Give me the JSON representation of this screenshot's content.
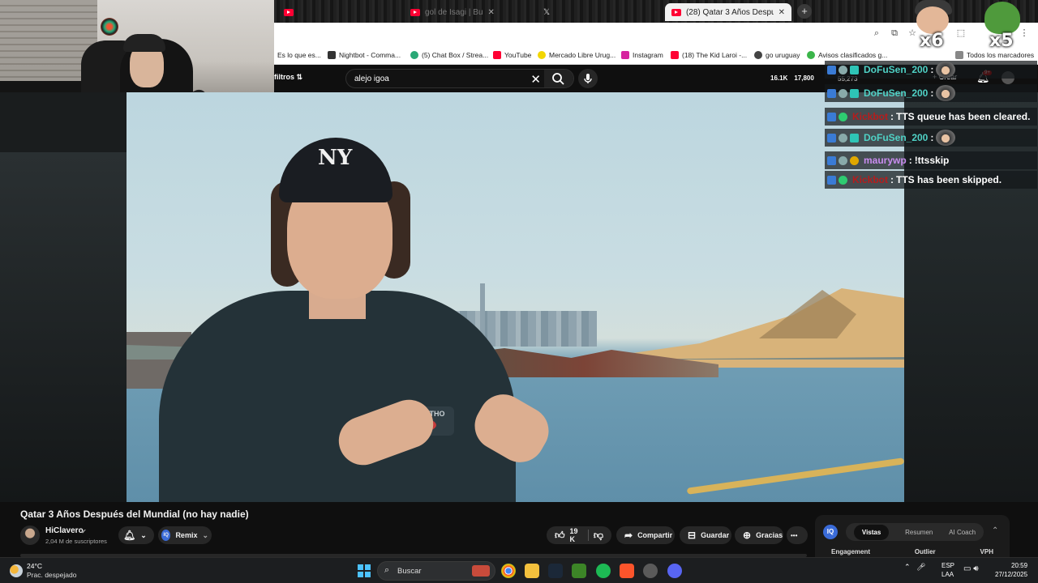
{
  "browser": {
    "tabs": [
      {
        "label": "",
        "icon": "youtube-icon"
      },
      {
        "label": "gol de Isagi | Bu",
        "icon": "youtube-icon"
      },
      {
        "label": "",
        "icon": "x-icon"
      },
      {
        "label": "(28) Qatar 3 Años Después del",
        "icon": "youtube-icon",
        "active": true
      }
    ],
    "new_tab": "+",
    "bookmarks": [
      {
        "label": "Es lo que es...",
        "color": "#888888"
      },
      {
        "label": "Nightbot - Comma...",
        "color": "#333333"
      },
      {
        "label": "(5) Chat Box / Strea...",
        "color": "#2aa876"
      },
      {
        "label": "YouTube",
        "color": "#ff0033"
      },
      {
        "label": "Mercado Libre Urug...",
        "color": "#f2d600"
      },
      {
        "label": "Instagram",
        "color": "#d6249f"
      },
      {
        "label": "(18) The Kid Laroi -...",
        "color": "#ff0033"
      },
      {
        "label": "go uruguay",
        "color": "#444444"
      },
      {
        "label": "Avisos clasificados g...",
        "color": "#3bb54a"
      },
      {
        "label": "Todos los marcadores",
        "color": "#666666"
      }
    ]
  },
  "youtube": {
    "filters_label": "filtros",
    "search_value": "alejo igoa",
    "stats": [
      "16.1K",
      "17,800",
      "55,273"
    ],
    "create_label": "Crear",
    "notif_count": "9+",
    "video_title": "Qatar 3 Años Después del Mundial (no hay nadie)",
    "cap_logo": "NY",
    "shirt_text": "BEANYTHO",
    "channel_name": "HiClavero",
    "subscribers": "2,04 M de suscriptores",
    "remix_label": "Remix",
    "likes": "19 K",
    "share_label": "Compartir",
    "save_label": "Guardar",
    "thanks_label": "Gracias",
    "more_label": "•••"
  },
  "chat": [
    {
      "user": "DoFuSen_200",
      "user_color": "#4fd1c5",
      "message": "",
      "emote": true
    },
    {
      "user": "DoFuSen_200",
      "user_color": "#4fd1c5",
      "message": "",
      "emote": true
    },
    {
      "user": "Kickbot",
      "user_color": "#b71c1c",
      "message": "TTS queue has been cleared.",
      "emote": false
    },
    {
      "user": "DoFuSen_200",
      "user_color": "#4fd1c5",
      "message": "",
      "emote": true
    },
    {
      "user": "maurywp",
      "user_color": "#c98cf0",
      "message": "!ttsskip",
      "emote": false
    },
    {
      "user": "Kickbot",
      "user_color": "#b71c1c",
      "message": "TTS has been skipped.",
      "emote": false
    }
  ],
  "overlays": {
    "emote_count_1": "x6",
    "emote_count_2": "x5"
  },
  "side_panel": {
    "logo": "IQ",
    "tabs": [
      "Vistas",
      "Resumen",
      "AI Coach"
    ],
    "columns": [
      "Engagement",
      "Outlier",
      "VPH"
    ]
  },
  "taskbar": {
    "temperature": "24°C",
    "weather": "Prac. despejado",
    "search_placeholder": "Buscar",
    "lang1": "ESP",
    "lang2": "LAA",
    "time": "20:59",
    "date": "27/12/2025"
  }
}
